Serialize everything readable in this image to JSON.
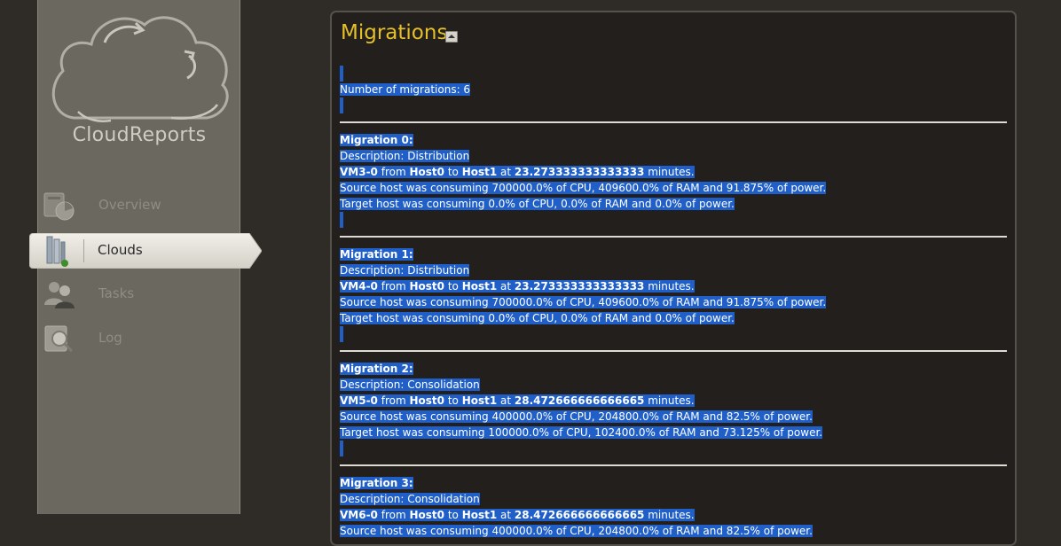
{
  "app": {
    "name": "CloudReports"
  },
  "nav": {
    "overview": "Overview",
    "clouds": "Clouds",
    "tasks": "Tasks",
    "log": "Log"
  },
  "panel": {
    "title": "Migrations",
    "count_text": "Number of migrations: 6"
  },
  "migrations": [
    {
      "heading": "Migration 0:",
      "description": "Description: Distribution",
      "vm": "VM3-0",
      "from_word": " from ",
      "source": "Host0",
      "to_word": " to ",
      "target": "Host1",
      "at_word": " at ",
      "time": "23.273333333333333",
      "unit": " minutes.",
      "source_line": "Source host was consuming 700000.0% of CPU, 409600.0% of RAM and 91.875% of power.",
      "target_line": "Target host was consuming 0.0% of CPU, 0.0% of RAM and 0.0% of power."
    },
    {
      "heading": "Migration 1:",
      "description": "Description: Distribution",
      "vm": "VM4-0",
      "from_word": " from ",
      "source": "Host0",
      "to_word": " to ",
      "target": "Host1",
      "at_word": " at ",
      "time": "23.273333333333333",
      "unit": " minutes.",
      "source_line": "Source host was consuming 700000.0% of CPU, 409600.0% of RAM and 91.875% of power.",
      "target_line": "Target host was consuming 0.0% of CPU, 0.0% of RAM and 0.0% of power."
    },
    {
      "heading": "Migration 2:",
      "description": "Description: Consolidation",
      "vm": "VM5-0",
      "from_word": " from ",
      "source": "Host0",
      "to_word": " to ",
      "target": "Host1",
      "at_word": " at ",
      "time": "28.472666666666665",
      "unit": " minutes.",
      "source_line": "Source host was consuming 400000.0% of CPU, 204800.0% of RAM and 82.5% of power.",
      "target_line": "Target host was consuming 100000.0% of CPU, 102400.0% of RAM and 73.125% of power."
    },
    {
      "heading": "Migration 3:",
      "description": "Description: Consolidation",
      "vm": "VM6-0",
      "from_word": " from ",
      "source": "Host0",
      "to_word": " to ",
      "target": "Host1",
      "at_word": " at ",
      "time": "28.472666666666665",
      "unit": " minutes.",
      "source_line": "Source host was consuming 400000.0% of CPU, 204800.0% of RAM and 82.5% of power."
    }
  ],
  "colors": {
    "title": "#e6c02a",
    "selection": "#1f5fc7",
    "panel_bg": "#221f1c"
  }
}
